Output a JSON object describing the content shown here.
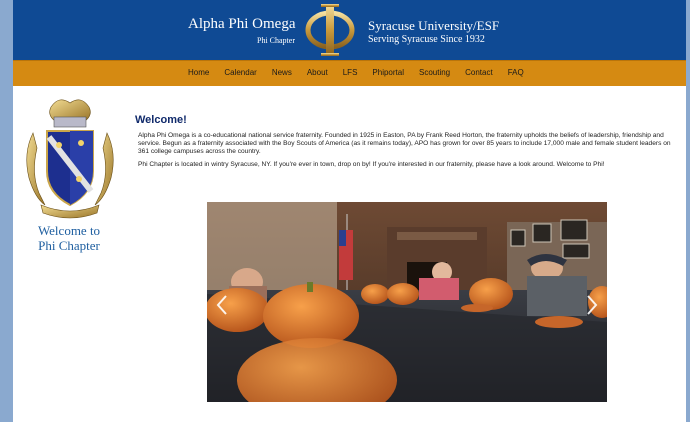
{
  "header": {
    "org_name": "Alpha Phi Omega",
    "chapter_name": "Phi Chapter",
    "university": "Syracuse University/ESF",
    "tagline": "Serving Syracuse Since 1932"
  },
  "nav": {
    "items": [
      "Home",
      "Calendar",
      "News",
      "About",
      "LFS",
      "Phiportal",
      "Scouting",
      "Contact",
      "FAQ"
    ]
  },
  "sidebar": {
    "welcome_line1": "Welcome to",
    "welcome_line2": "Phi Chapter"
  },
  "main": {
    "heading": "Welcome!",
    "paragraph1": "Alpha Phi Omega is a co-educational national service fraternity. Founded in 1925 in Easton, PA by Frank Reed Horton, the fraternity upholds the beliefs of leadership, friendship and service. Begun as a fraternity associated with the Boy Scouts of America (as it remains today), APO has grown for over 85 years to include 17,000 male and female student leaders on 361 college campuses across the country.",
    "paragraph2": "Phi Chapter is located in wintry Syracuse, NY. If you're ever in town, drop on by! If you're interested in our fraternity, please have a look around. Welcome to Phi!"
  },
  "colors": {
    "header_bg": "#0f4a94",
    "nav_bg": "#d58a12",
    "page_bg": "#8aa9cf"
  }
}
